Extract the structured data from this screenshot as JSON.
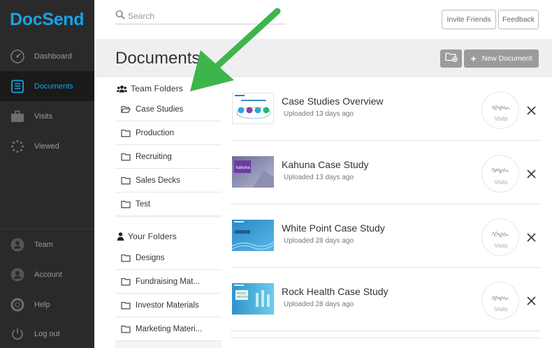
{
  "app": {
    "logo": "DocSend"
  },
  "sidebar": {
    "items": [
      {
        "label": "Dashboard",
        "icon": "dashboard-icon"
      },
      {
        "label": "Documents",
        "icon": "documents-icon",
        "active": true
      },
      {
        "label": "Visits",
        "icon": "briefcase-icon"
      },
      {
        "label": "Viewed",
        "icon": "viewed-icon"
      }
    ],
    "bottom_items": [
      {
        "label": "Team",
        "icon": "team-icon"
      },
      {
        "label": "Account",
        "icon": "account-icon"
      },
      {
        "label": "Help",
        "icon": "help-icon"
      },
      {
        "label": "Log out",
        "icon": "power-icon"
      }
    ]
  },
  "topbar": {
    "search_placeholder": "Search",
    "invite_label": "Invite Friends",
    "feedback_label": "Feedback"
  },
  "header": {
    "title": "Documents",
    "new_document_label": "New Document"
  },
  "team_folders": {
    "heading": "Team Folders",
    "items": [
      "Case Studies",
      "Production",
      "Recruiting",
      "Sales Decks",
      "Test"
    ],
    "selected": "Case Studies"
  },
  "your_folders": {
    "heading": "Your Folders",
    "items": [
      "Designs",
      "Fundraising Mat...",
      "Investor Materials",
      "Marketing Materi..."
    ]
  },
  "documents": [
    {
      "title": "Case Studies Overview",
      "uploaded": "Uploaded 13 days ago",
      "visits_label": "Visits"
    },
    {
      "title": "Kahuna Case Study",
      "uploaded": "Uploaded 13 days ago",
      "visits_label": "Visits"
    },
    {
      "title": "White Point Case Study",
      "uploaded": "Uploaded 28 days ago",
      "visits_label": "Visits"
    },
    {
      "title": "Rock Health Case Study",
      "uploaded": "Uploaded 28 days ago",
      "visits_label": "Visits"
    }
  ],
  "colors": {
    "brand": "#19a3e8",
    "sidebar_bg": "#2a2a2a",
    "annotation_arrow": "#3db54a"
  }
}
